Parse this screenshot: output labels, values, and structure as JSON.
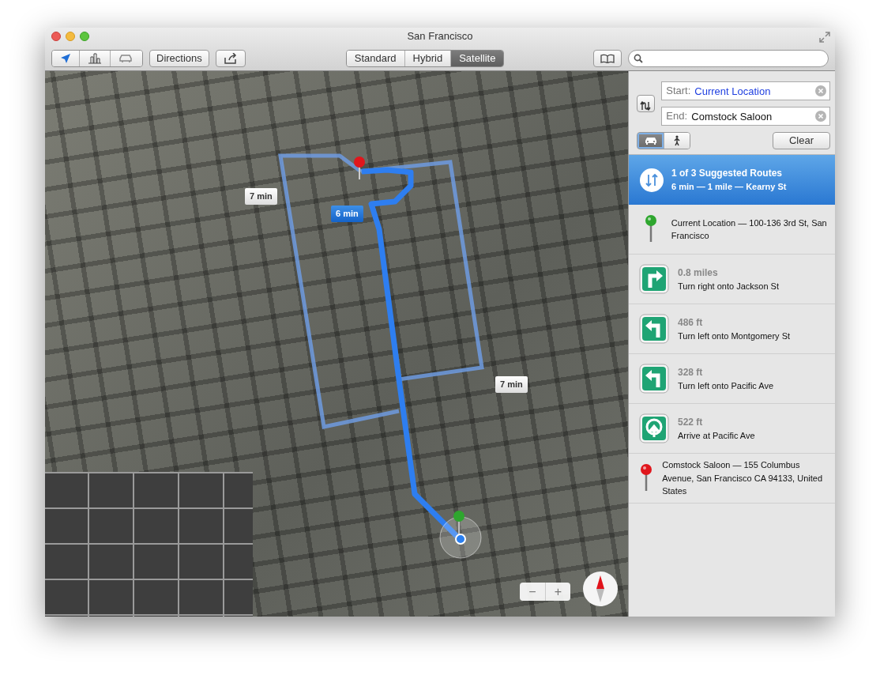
{
  "window": {
    "title": "San Francisco"
  },
  "toolbar": {
    "directions_button": "Directions",
    "map_types": [
      {
        "label": "Standard",
        "selected": false
      },
      {
        "label": "Hybrid",
        "selected": false
      },
      {
        "label": "Satellite",
        "selected": true
      }
    ]
  },
  "map": {
    "route_labels": [
      {
        "text": "7 min",
        "selected": false
      },
      {
        "text": "6 min",
        "selected": true
      },
      {
        "text": "7 min",
        "selected": false
      }
    ],
    "zoom_out": "−",
    "zoom_in": "+"
  },
  "directions": {
    "start": {
      "label": "Start:",
      "value": "Current Location"
    },
    "end": {
      "label": "End:",
      "value": "Comstock Saloon"
    },
    "modes": [
      {
        "kind": "car",
        "selected": true
      },
      {
        "kind": "walk",
        "selected": false
      }
    ],
    "clear_button": "Clear"
  },
  "route_summary": {
    "title": "1 of 3 Suggested Routes",
    "detail": "6 min — 1 mile — Kearny St",
    "selected": true
  },
  "steps": [
    {
      "kind": "start-pin",
      "text": "Current Location — 100-136 3rd St, San Francisco"
    },
    {
      "kind": "turn-right",
      "distance": "0.8 miles",
      "text": "Turn right onto Jackson St"
    },
    {
      "kind": "turn-left",
      "distance": "486 ft",
      "text": "Turn left onto Montgomery St"
    },
    {
      "kind": "turn-left",
      "distance": "328 ft",
      "text": "Turn left onto Pacific Ave"
    },
    {
      "kind": "arrive",
      "distance": "522 ft",
      "text": "Arrive at Pacific Ave"
    },
    {
      "kind": "end-pin",
      "text": "Comstock Saloon — 155 Columbus Avenue, San Francisco CA 94133, United States"
    }
  ]
}
